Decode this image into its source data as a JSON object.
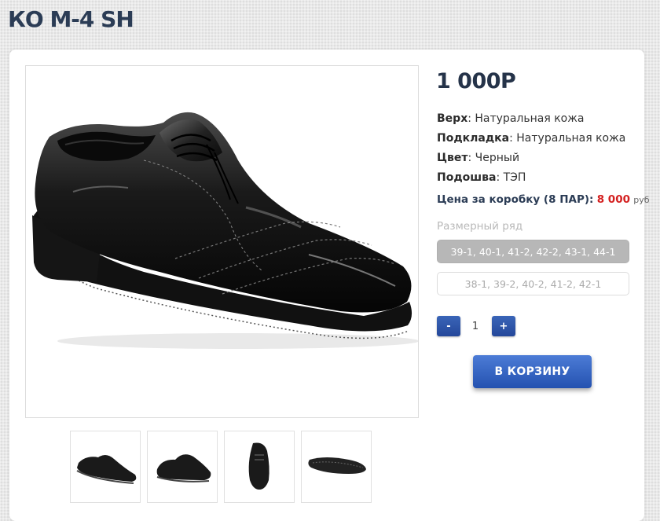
{
  "product": {
    "title": "КО М-4 SH",
    "price": "1 000Р"
  },
  "specs": [
    {
      "label": "Верх",
      "value": ": Натуральная кожа"
    },
    {
      "label": "Подкладка",
      "value": ": Натуральная кожа"
    },
    {
      "label": "Цвет",
      "value": ": Черный"
    },
    {
      "label": "Подошва",
      "value": ": ТЭП"
    }
  ],
  "box_price": {
    "label": "Цена за коробку (8 ПАР):",
    "value": "8 000",
    "currency": "руб"
  },
  "sizes": {
    "label": "Размерный ряд",
    "options": [
      "39-1, 40-1, 41-2, 42-2, 43-1, 44-1",
      "38-1, 39-2, 40-2, 41-2, 42-1"
    ],
    "selected_index": 0
  },
  "quantity": {
    "minus_label": "-",
    "plus_label": "+",
    "value": "1"
  },
  "cart_button": {
    "label": "В КОРЗИНУ"
  },
  "colors": {
    "accent": "#2a52a8",
    "price_red": "#d42020",
    "title": "#2b3c55"
  },
  "icons": {
    "main_image": "black-leather-shoe",
    "thumbnails": [
      "shoe-side-view",
      "shoe-front-angle",
      "shoe-top-view",
      "shoe-sole-view"
    ]
  }
}
